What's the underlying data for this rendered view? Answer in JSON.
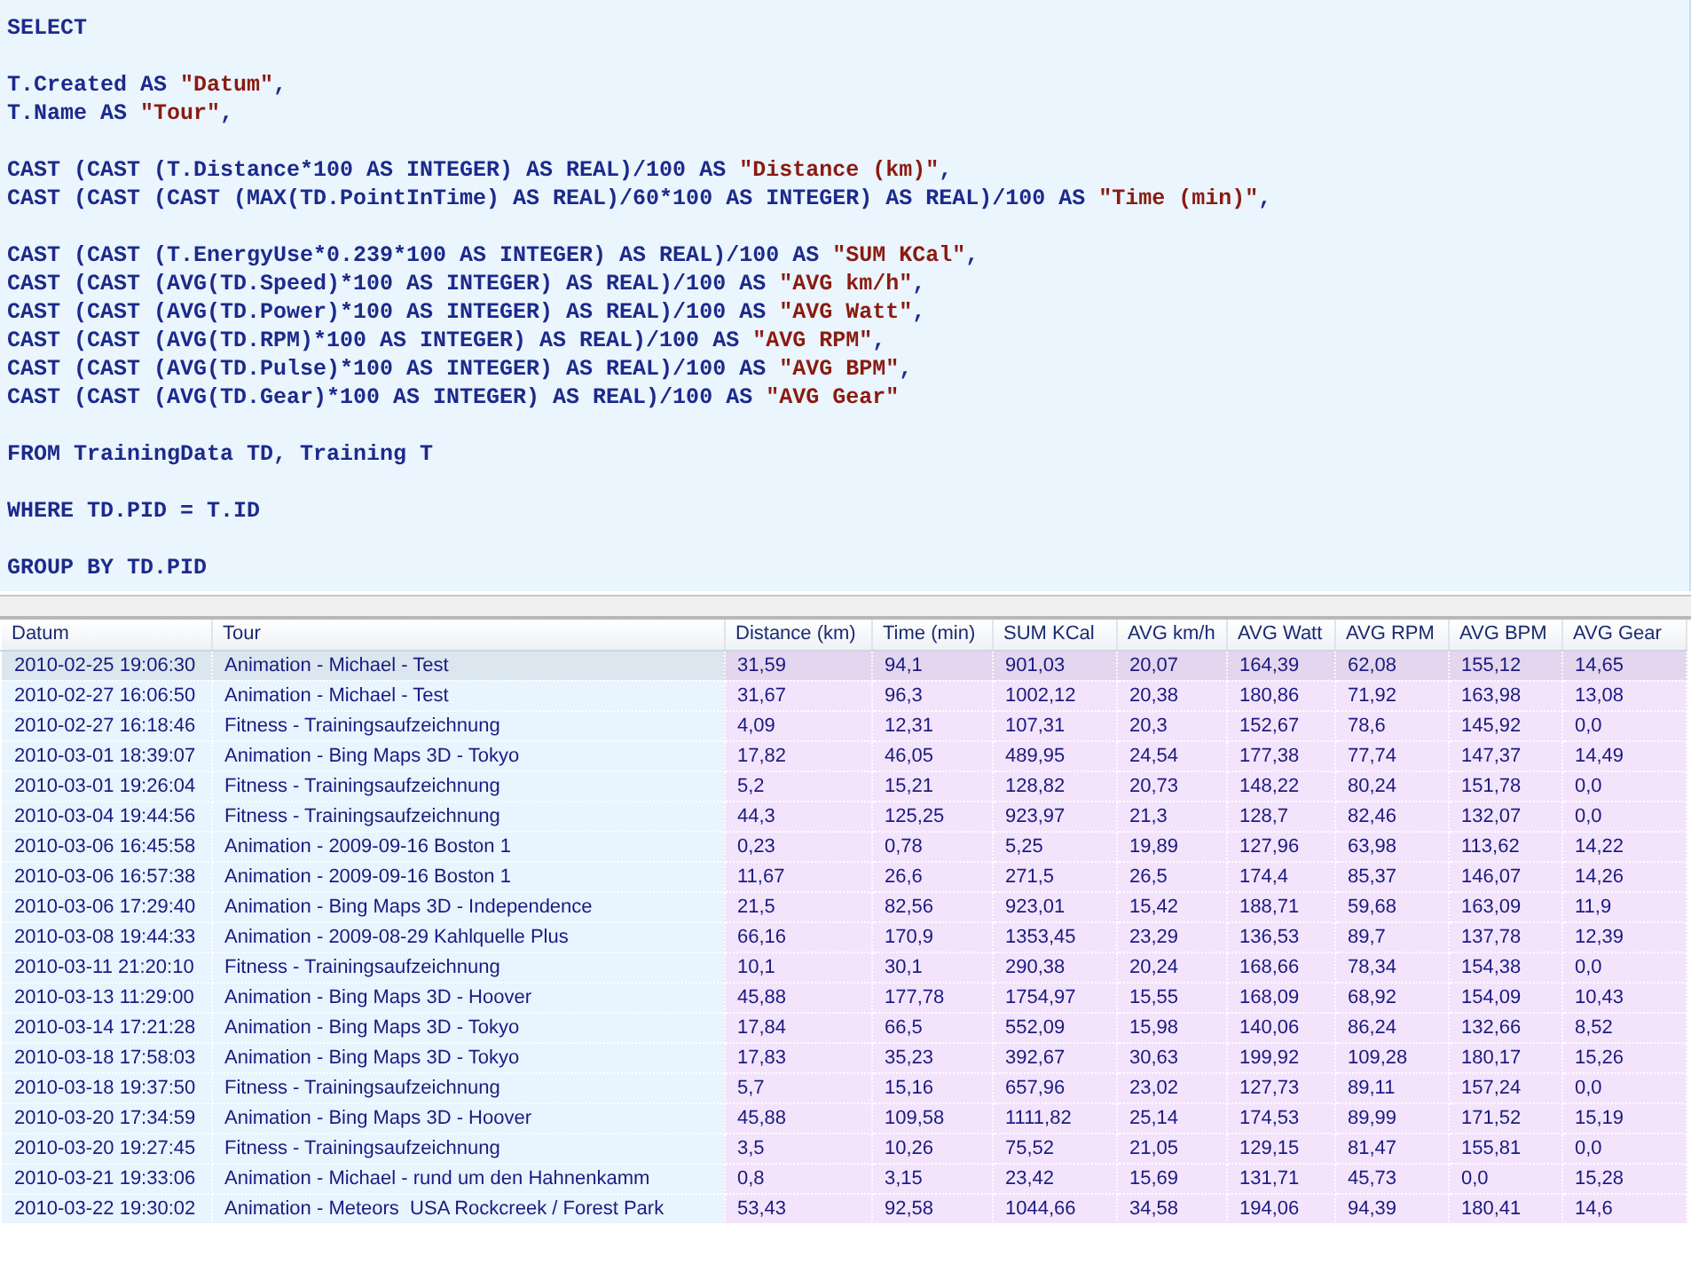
{
  "editor": {
    "blocks": [
      [
        [
          {
            "kind": "code",
            "text": "SELECT"
          }
        ]
      ],
      [
        [
          {
            "kind": "code",
            "text": "T.Created AS "
          },
          {
            "kind": "string",
            "text": "\"Datum\""
          },
          {
            "kind": "code",
            "text": ","
          }
        ],
        [
          {
            "kind": "code",
            "text": "T.Name AS "
          },
          {
            "kind": "string",
            "text": "\"Tour\""
          },
          {
            "kind": "code",
            "text": ","
          }
        ]
      ],
      [
        [
          {
            "kind": "code",
            "text": "CAST (CAST (T.Distance*100 AS INTEGER) AS REAL)/100 AS "
          },
          {
            "kind": "string",
            "text": "\"Distance (km)\""
          },
          {
            "kind": "code",
            "text": ","
          }
        ],
        [
          {
            "kind": "code",
            "text": "CAST (CAST (CAST (MAX(TD.PointInTime) AS REAL)/60*100 AS INTEGER) AS REAL)/100 AS "
          },
          {
            "kind": "string",
            "text": "\"Time (min)\""
          },
          {
            "kind": "code",
            "text": ","
          }
        ]
      ],
      [
        [
          {
            "kind": "code",
            "text": "CAST (CAST (T.EnergyUse*0.239*100 AS INTEGER) AS REAL)/100 AS "
          },
          {
            "kind": "string",
            "text": "\"SUM KCal\""
          },
          {
            "kind": "code",
            "text": ","
          }
        ],
        [
          {
            "kind": "code",
            "text": "CAST (CAST (AVG(TD.Speed)*100 AS INTEGER) AS REAL)/100 AS "
          },
          {
            "kind": "string",
            "text": "\"AVG km/h\""
          },
          {
            "kind": "code",
            "text": ","
          }
        ],
        [
          {
            "kind": "code",
            "text": "CAST (CAST (AVG(TD.Power)*100 AS INTEGER) AS REAL)/100 AS "
          },
          {
            "kind": "string",
            "text": "\"AVG Watt\""
          },
          {
            "kind": "code",
            "text": ","
          }
        ],
        [
          {
            "kind": "code",
            "text": "CAST (CAST (AVG(TD.RPM)*100 AS INTEGER) AS REAL)/100 AS "
          },
          {
            "kind": "string",
            "text": "\"AVG RPM\""
          },
          {
            "kind": "code",
            "text": ","
          }
        ],
        [
          {
            "kind": "code",
            "text": "CAST (CAST (AVG(TD.Pulse)*100 AS INTEGER) AS REAL)/100 AS "
          },
          {
            "kind": "string",
            "text": "\"AVG BPM\""
          },
          {
            "kind": "code",
            "text": ","
          }
        ],
        [
          {
            "kind": "code",
            "text": "CAST (CAST (AVG(TD.Gear)*100 AS INTEGER) AS REAL)/100 AS "
          },
          {
            "kind": "string",
            "text": "\"AVG Gear\""
          }
        ]
      ],
      [
        [
          {
            "kind": "code",
            "text": "FROM TrainingData TD, Training T"
          }
        ]
      ],
      [
        [
          {
            "kind": "code",
            "text": "WHERE TD.PID = T.ID"
          }
        ]
      ],
      [
        [
          {
            "kind": "code",
            "text": "GROUP BY TD.PID"
          }
        ]
      ]
    ]
  },
  "table": {
    "columns": [
      "Datum",
      "Tour",
      "Distance (km)",
      "Time (min)",
      "SUM KCal",
      "AVG km/h",
      "AVG Watt",
      "AVG RPM",
      "AVG BPM",
      "AVG Gear"
    ],
    "rows": [
      {
        "selected": true,
        "cells": [
          "2010-02-25 19:06:30",
          "Animation - Michael - Test",
          "31,59",
          "94,1",
          "901,03",
          "20,07",
          "164,39",
          "62,08",
          "155,12",
          "14,65"
        ]
      },
      {
        "selected": false,
        "cells": [
          "2010-02-27 16:06:50",
          "Animation - Michael - Test",
          "31,67",
          "96,3",
          "1002,12",
          "20,38",
          "180,86",
          "71,92",
          "163,98",
          "13,08"
        ]
      },
      {
        "selected": false,
        "cells": [
          "2010-02-27 16:18:46",
          "Fitness - Trainingsaufzeichnung",
          "4,09",
          "12,31",
          "107,31",
          "20,3",
          "152,67",
          "78,6",
          "145,92",
          "0,0"
        ]
      },
      {
        "selected": false,
        "cells": [
          "2010-03-01 18:39:07",
          "Animation - Bing Maps 3D - Tokyo",
          "17,82",
          "46,05",
          "489,95",
          "24,54",
          "177,38",
          "77,74",
          "147,37",
          "14,49"
        ]
      },
      {
        "selected": false,
        "cells": [
          "2010-03-01 19:26:04",
          "Fitness - Trainingsaufzeichnung",
          "5,2",
          "15,21",
          "128,82",
          "20,73",
          "148,22",
          "80,24",
          "151,78",
          "0,0"
        ]
      },
      {
        "selected": false,
        "cells": [
          "2010-03-04 19:44:56",
          "Fitness - Trainingsaufzeichnung",
          "44,3",
          "125,25",
          "923,97",
          "21,3",
          "128,7",
          "82,46",
          "132,07",
          "0,0"
        ]
      },
      {
        "selected": false,
        "cells": [
          "2010-03-06 16:45:58",
          "Animation - 2009-09-16 Boston 1",
          "0,23",
          "0,78",
          "5,25",
          "19,89",
          "127,96",
          "63,98",
          "113,62",
          "14,22"
        ]
      },
      {
        "selected": false,
        "cells": [
          "2010-03-06 16:57:38",
          "Animation - 2009-09-16 Boston 1",
          "11,67",
          "26,6",
          "271,5",
          "26,5",
          "174,4",
          "85,37",
          "146,07",
          "14,26"
        ]
      },
      {
        "selected": false,
        "cells": [
          "2010-03-06 17:29:40",
          "Animation - Bing Maps 3D - Independence",
          "21,5",
          "82,56",
          "923,01",
          "15,42",
          "188,71",
          "59,68",
          "163,09",
          "11,9"
        ]
      },
      {
        "selected": false,
        "cells": [
          "2010-03-08 19:44:33",
          "Animation - 2009-08-29 Kahlquelle Plus",
          "66,16",
          "170,9",
          "1353,45",
          "23,29",
          "136,53",
          "89,7",
          "137,78",
          "12,39"
        ]
      },
      {
        "selected": false,
        "cells": [
          "2010-03-11 21:20:10",
          "Fitness - Trainingsaufzeichnung",
          "10,1",
          "30,1",
          "290,38",
          "20,24",
          "168,66",
          "78,34",
          "154,38",
          "0,0"
        ]
      },
      {
        "selected": false,
        "cells": [
          "2010-03-13 11:29:00",
          "Animation - Bing Maps 3D - Hoover",
          "45,88",
          "177,78",
          "1754,97",
          "15,55",
          "168,09",
          "68,92",
          "154,09",
          "10,43"
        ]
      },
      {
        "selected": false,
        "cells": [
          "2010-03-14 17:21:28",
          "Animation - Bing Maps 3D - Tokyo",
          "17,84",
          "66,5",
          "552,09",
          "15,98",
          "140,06",
          "86,24",
          "132,66",
          "8,52"
        ]
      },
      {
        "selected": false,
        "cells": [
          "2010-03-18 17:58:03",
          "Animation - Bing Maps 3D - Tokyo",
          "17,83",
          "35,23",
          "392,67",
          "30,63",
          "199,92",
          "109,28",
          "180,17",
          "15,26"
        ]
      },
      {
        "selected": false,
        "cells": [
          "2010-03-18 19:37:50",
          "Fitness - Trainingsaufzeichnung",
          "5,7",
          "15,16",
          "657,96",
          "23,02",
          "127,73",
          "89,11",
          "157,24",
          "0,0"
        ]
      },
      {
        "selected": false,
        "cells": [
          "2010-03-20 17:34:59",
          "Animation - Bing Maps 3D - Hoover",
          "45,88",
          "109,58",
          "1111,82",
          "25,14",
          "174,53",
          "89,99",
          "171,52",
          "15,19"
        ]
      },
      {
        "selected": false,
        "cells": [
          "2010-03-20 19:27:45",
          "Fitness - Trainingsaufzeichnung",
          "3,5",
          "10,26",
          "75,52",
          "21,05",
          "129,15",
          "81,47",
          "155,81",
          "0,0"
        ]
      },
      {
        "selected": false,
        "cells": [
          "2010-03-21 19:33:06",
          "Animation - Michael - rund um den Hahnenkamm",
          "0,8",
          "3,15",
          "23,42",
          "15,69",
          "131,71",
          "45,73",
          "0,0",
          "15,28"
        ]
      },
      {
        "selected": false,
        "cells": [
          "2010-03-22 19:30:02",
          "Animation - Meteors  USA Rockcreek / Forest Park",
          "53,43",
          "92,58",
          "1044,66",
          "34,58",
          "194,06",
          "94,39",
          "180,41",
          "14,6"
        ]
      }
    ]
  }
}
